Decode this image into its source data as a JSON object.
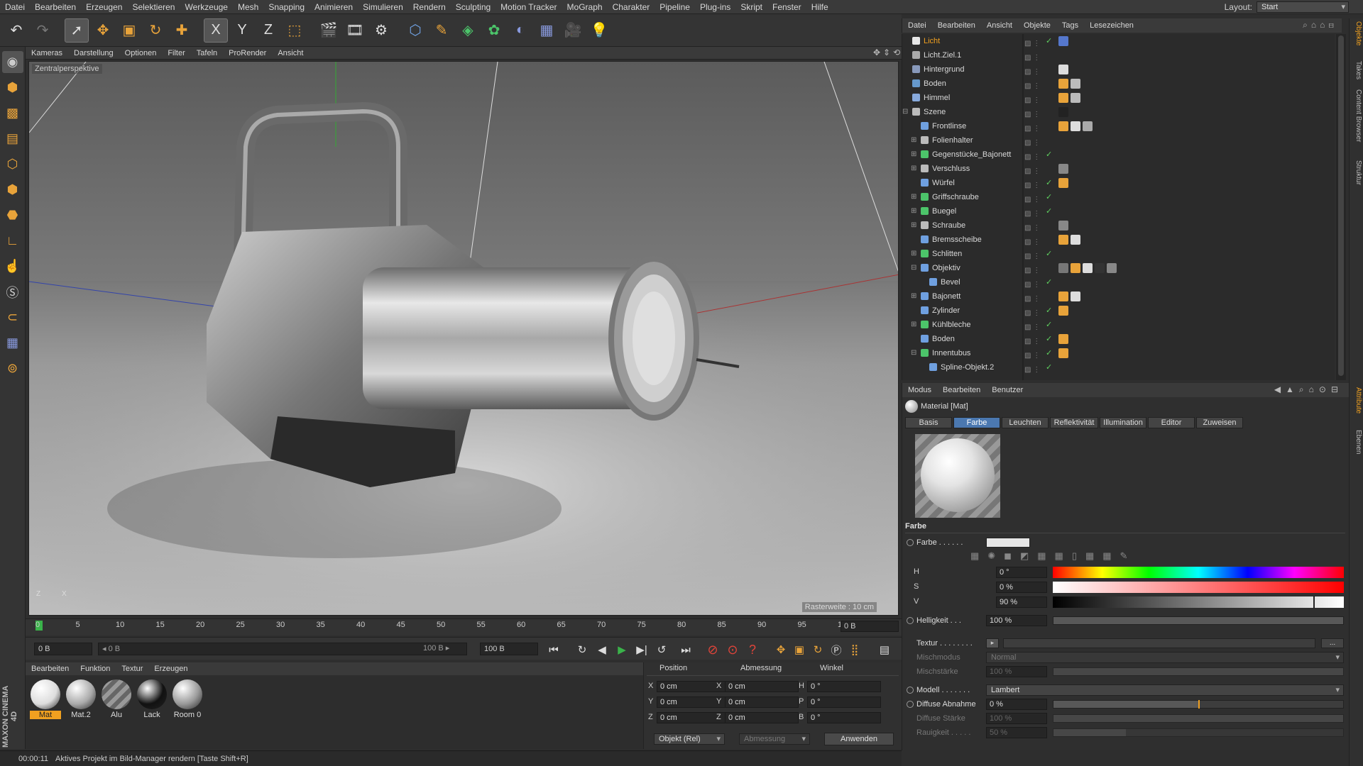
{
  "menu": [
    "Datei",
    "Bearbeiten",
    "Erzeugen",
    "Selektieren",
    "Werkzeuge",
    "Mesh",
    "Snapping",
    "Animieren",
    "Simulieren",
    "Rendern",
    "Sculpting",
    "Motion Tracker",
    "MoGraph",
    "Charakter",
    "Pipeline",
    "Plug-ins",
    "Skript",
    "Fenster",
    "Hilfe"
  ],
  "layout": {
    "label": "Layout:",
    "value": "Start"
  },
  "toolbar_axes": {
    "x": "X",
    "y": "Y",
    "z": "Z"
  },
  "viewport": {
    "menu": [
      "Ansicht",
      "Kameras",
      "Darstellung",
      "Optionen",
      "Filter",
      "Tafeln",
      "ProRender"
    ],
    "label": "Zentralperspektive",
    "grid": "Rasterweite : 10 cm",
    "axis_z": "Z",
    "axis_x": "X"
  },
  "timeline": {
    "ticks": [
      "0",
      "5",
      "10",
      "15",
      "20",
      "25",
      "30",
      "35",
      "40",
      "45",
      "50",
      "55",
      "60",
      "65",
      "70",
      "75",
      "80",
      "85",
      "90",
      "95",
      "100"
    ],
    "frame": "0 B"
  },
  "transport": {
    "start": "0 B",
    "range_start": "◂ 0 B",
    "range_end": "100 B ▸",
    "end": "100 B"
  },
  "material_manager": {
    "menu": [
      "Erzeugen",
      "Bearbeiten",
      "Funktion",
      "Textur"
    ],
    "materials": [
      {
        "name": "Mat",
        "color": "#ddd"
      },
      {
        "name": "Mat.2",
        "color": "#aaa"
      },
      {
        "name": "Alu",
        "color": "#888"
      },
      {
        "name": "Lack",
        "color": "#111"
      },
      {
        "name": "Room 0",
        "color": "#999"
      }
    ],
    "brand": "MAXON CINEMA 4D"
  },
  "coordinates": {
    "headers": {
      "position": "Position",
      "size": "Abmessung",
      "rotation": "Winkel"
    },
    "rows": [
      {
        "axis": "X",
        "pos": "0 cm",
        "size_axis": "X",
        "size": "0 cm",
        "rot_axis": "H",
        "rot": "0 °"
      },
      {
        "axis": "Y",
        "pos": "0 cm",
        "size_axis": "Y",
        "size": "0 cm",
        "rot_axis": "P",
        "rot": "0 °"
      },
      {
        "axis": "Z",
        "pos": "0 cm",
        "size_axis": "Z",
        "size": "0 cm",
        "rot_axis": "B",
        "rot": "0 °"
      }
    ],
    "mode": "Objekt (Rel)",
    "size_mode": "Abmessung",
    "apply": "Anwenden"
  },
  "status": {
    "time": "00:00:11",
    "text": "Aktives Projekt im Bild-Manager rendern [Taste Shift+R]"
  },
  "object_manager": {
    "menu": [
      "Datei",
      "Bearbeiten",
      "Ansicht",
      "Objekte",
      "Tags",
      "Lesezeichen"
    ],
    "objects": [
      {
        "name": "Licht",
        "depth": 0,
        "icon": "#e6e6e6",
        "highlight": true,
        "expand": "",
        "check": true,
        "tags": [
          "#5577cc"
        ]
      },
      {
        "name": "Licht.Ziel.1",
        "depth": 0,
        "icon": "#aaa",
        "expand": "",
        "check": false,
        "tags": []
      },
      {
        "name": "Hintergrund",
        "depth": 0,
        "icon": "#8899bb",
        "expand": "",
        "check": false,
        "tags": [
          "#ddd"
        ]
      },
      {
        "name": "Boden",
        "depth": 0,
        "icon": "#6699cc",
        "expand": "",
        "check": false,
        "tags": [
          "#e8a33a",
          "#bbb"
        ]
      },
      {
        "name": "Himmel",
        "depth": 0,
        "icon": "#88aadd",
        "expand": "",
        "check": false,
        "tags": [
          "#e8a33a",
          "#bbb"
        ]
      },
      {
        "name": "Szene",
        "depth": 0,
        "icon": "#bbb",
        "expand": "⊟",
        "check": false,
        "tags": [
          "#222"
        ]
      },
      {
        "name": "Frontlinse",
        "depth": 1,
        "icon": "#6fa0e0",
        "expand": "",
        "check": false,
        "tags": [
          "#e8a33a",
          "#ddd",
          "#aaa"
        ]
      },
      {
        "name": "Folienhalter",
        "depth": 1,
        "icon": "#bbb",
        "expand": "⊞",
        "check": false,
        "tags": []
      },
      {
        "name": "Gegenstücke_Bajonett",
        "depth": 1,
        "icon": "#4cc46a",
        "expand": "⊞",
        "check": true,
        "tags": []
      },
      {
        "name": "Verschluss",
        "depth": 1,
        "icon": "#bbb",
        "expand": "⊞",
        "check": false,
        "tags": [
          "#888"
        ]
      },
      {
        "name": "Würfel",
        "depth": 1,
        "icon": "#6fa0e0",
        "expand": "",
        "check": true,
        "tags": [
          "#e8a33a"
        ]
      },
      {
        "name": "Griffschraube",
        "depth": 1,
        "icon": "#4cc46a",
        "expand": "⊞",
        "check": true,
        "tags": []
      },
      {
        "name": "Buegel",
        "depth": 1,
        "icon": "#4cc46a",
        "expand": "⊞",
        "check": true,
        "tags": []
      },
      {
        "name": "Schraube",
        "depth": 1,
        "icon": "#bbb",
        "expand": "⊞",
        "check": false,
        "tags": [
          "#888"
        ]
      },
      {
        "name": "Bremsscheibe",
        "depth": 1,
        "icon": "#6fa0e0",
        "expand": "",
        "check": false,
        "tags": [
          "#e8a33a",
          "#ddd"
        ]
      },
      {
        "name": "Schlitten",
        "depth": 1,
        "icon": "#4cc46a",
        "expand": "⊞",
        "check": true,
        "tags": []
      },
      {
        "name": "Objektiv",
        "depth": 1,
        "icon": "#6fa0e0",
        "expand": "⊟",
        "check": false,
        "tags": [
          "#777",
          "#e8a33a",
          "#ddd",
          "#333",
          "#888"
        ]
      },
      {
        "name": "Bevel",
        "depth": 2,
        "icon": "#6fa0e0",
        "expand": "",
        "check": true,
        "tags": []
      },
      {
        "name": "Bajonett",
        "depth": 1,
        "icon": "#6fa0e0",
        "expand": "⊞",
        "check": false,
        "tags": [
          "#e8a33a",
          "#ddd"
        ]
      },
      {
        "name": "Zylinder",
        "depth": 1,
        "icon": "#6fa0e0",
        "expand": "",
        "check": true,
        "tags": [
          "#e8a33a"
        ]
      },
      {
        "name": "Kühlbleche",
        "depth": 1,
        "icon": "#4cc46a",
        "expand": "⊞",
        "check": true,
        "tags": []
      },
      {
        "name": "Boden",
        "depth": 1,
        "icon": "#6fa0e0",
        "expand": "",
        "check": true,
        "tags": [
          "#e8a33a"
        ]
      },
      {
        "name": "Innentubus",
        "depth": 1,
        "icon": "#4cc46a",
        "expand": "⊟",
        "check": true,
        "tags": [
          "#e8a33a"
        ]
      },
      {
        "name": "Spline-Objekt.2",
        "depth": 2,
        "icon": "#6fa0e0",
        "expand": "",
        "check": true,
        "tags": []
      }
    ]
  },
  "right_tabs": [
    "Objekte",
    "Takes",
    "Content Browser",
    "Struktur",
    "Attribute",
    "Ebenen"
  ],
  "attributes": {
    "menu": [
      "Modus",
      "Bearbeiten",
      "Benutzer"
    ],
    "title": "Material [Mat]",
    "tabs": [
      "Basis",
      "Farbe",
      "Leuchten",
      "Reflektivität",
      "Illumination",
      "Editor",
      "Zuweisen"
    ],
    "active_tab": "Farbe",
    "section": "Farbe",
    "color_label": "Farbe . . . . . .",
    "h": {
      "label": "H",
      "value": "0 °"
    },
    "s": {
      "label": "S",
      "value": "0 %"
    },
    "v": {
      "label": "V",
      "value": "90 %",
      "fraction": 0.9
    },
    "brightness": {
      "label": "Helligkeit . . .",
      "value": "100 %",
      "fraction": 1.0
    },
    "texture": {
      "label": "Textur . . . . . . . .",
      "button": "..."
    },
    "mix_mode": {
      "label": "Mischmodus",
      "value": "Normal"
    },
    "mix_strength": {
      "label": "Mischstärke",
      "value": "100 %",
      "fraction": 1.0
    },
    "model": {
      "label": "Modell . . . . . . .",
      "value": "Lambert"
    },
    "diffuse_falloff": {
      "label": "Diffuse Abnahme",
      "value": "0 %",
      "fraction": 0.5
    },
    "diffuse_strength": {
      "label": "Diffuse Stärke",
      "value": "100 %",
      "fraction": 1.0
    },
    "roughness": {
      "label": "Rauigkeit . . . . .",
      "value": "50 %",
      "fraction": 0.25
    }
  }
}
